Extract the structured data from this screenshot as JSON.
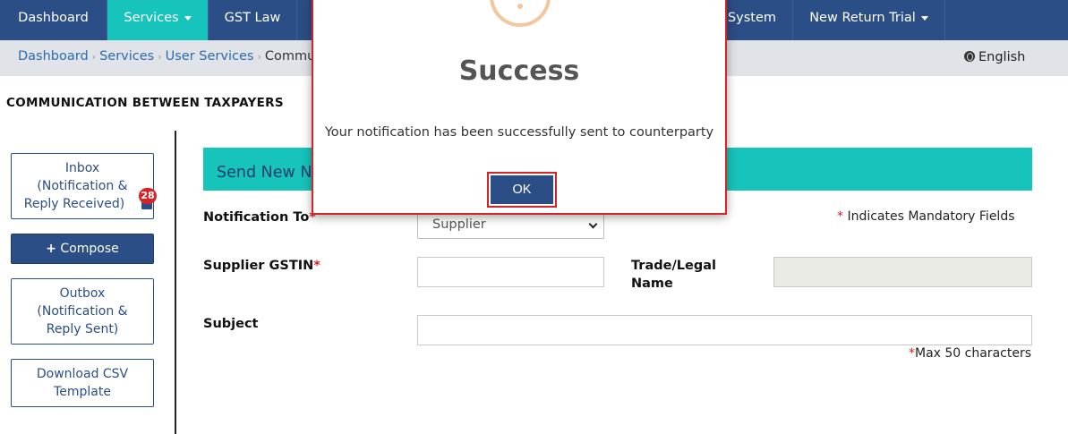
{
  "nav": {
    "items": [
      {
        "label": "Dashboard"
      },
      {
        "label": "Services"
      },
      {
        "label": "GST Law"
      },
      {
        "label": "System"
      },
      {
        "label": "New Return Trial"
      }
    ]
  },
  "breadcrumb": {
    "items": [
      "Dashboard",
      "User Services"
    ],
    "services": "Services",
    "current": "Commu"
  },
  "language": "English",
  "page": {
    "title": "COMMUNICATION BETWEEN TAXPAYERS"
  },
  "sidebar": {
    "inbox": {
      "line1": "Inbox",
      "line2": "(Notification &",
      "line3": "Reply Received)",
      "badge": "28"
    },
    "compose": {
      "label": "Compose"
    },
    "outbox": {
      "line1": "Outbox",
      "line2": "(Notification &",
      "line3": "Reply Sent)"
    },
    "csv": {
      "line1": "Download CSV",
      "line2": "Template"
    }
  },
  "form": {
    "section_title": "Send New No",
    "notification_to_label": "Notification To",
    "notification_to_value": "Supplier",
    "mandatory_note": "Indicates Mandatory Fields",
    "supplier_gstin_label": "Supplier GSTIN",
    "trade_label_1": "Trade/Legal",
    "trade_label_2": "Name",
    "subject_label": "Subject",
    "max_chars": "Max 50 characters",
    "required_mark": "*"
  },
  "modal": {
    "title": "Success",
    "message": "Your notification has been successfully sent to counterparty",
    "ok_label": "OK"
  },
  "colors": {
    "nav_bg": "#2c4e86",
    "accent_teal": "#17c4bb",
    "alert_red": "#d6232a",
    "warning_orange": "#f4c69d"
  }
}
